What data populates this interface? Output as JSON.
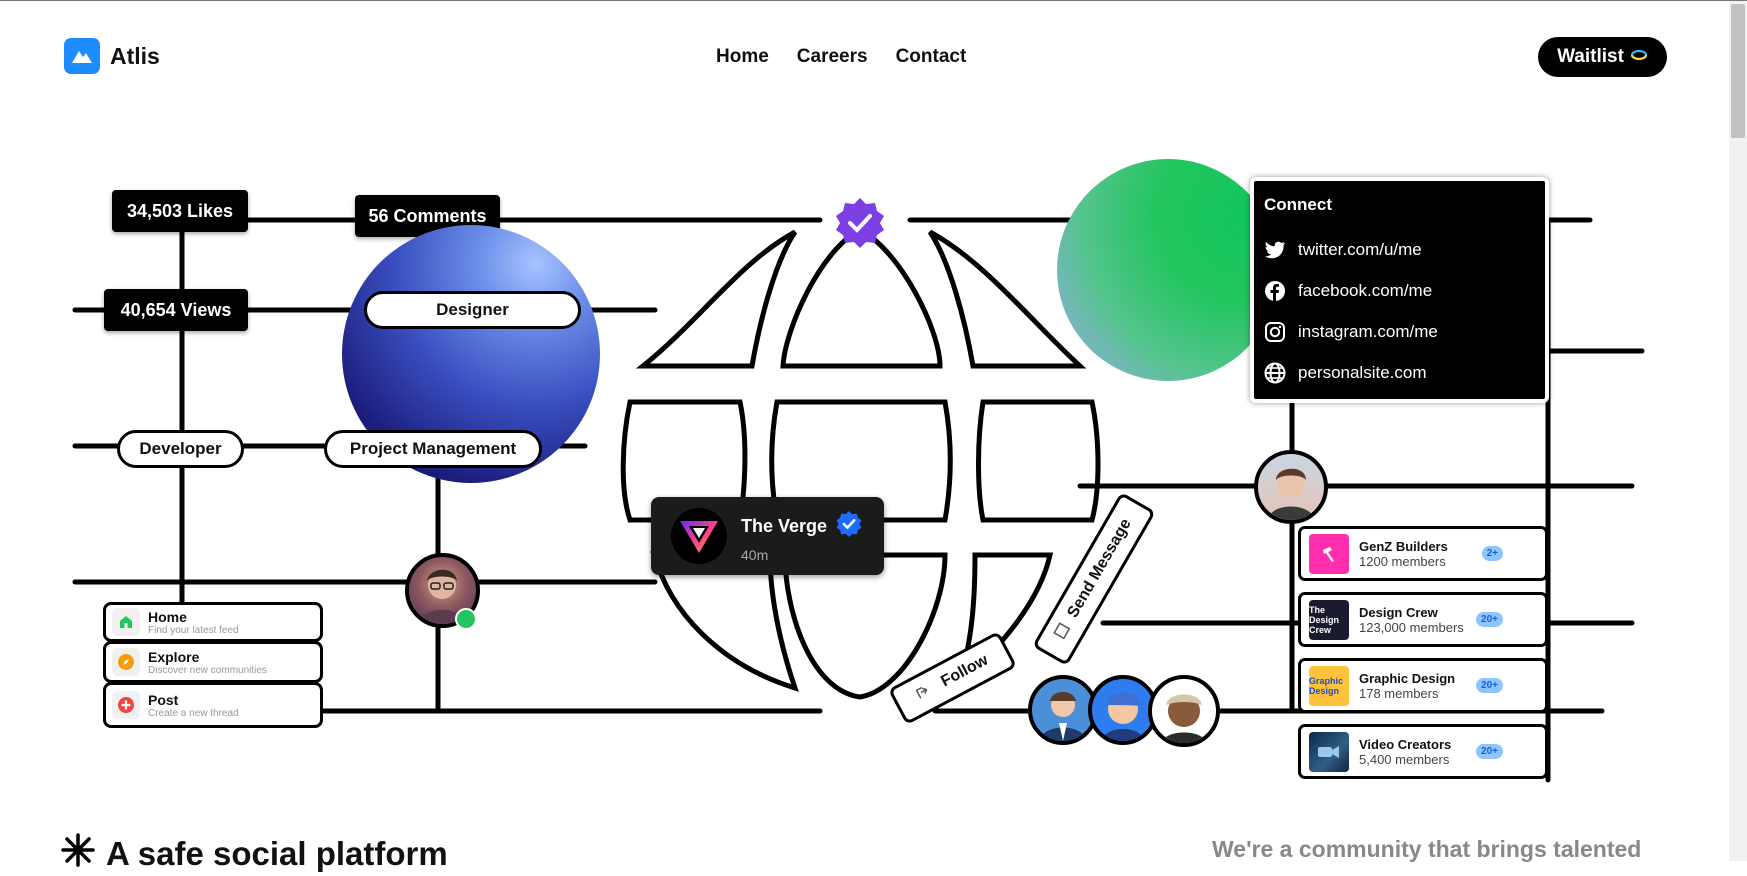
{
  "header": {
    "brand": "Atlis",
    "nav": [
      "Home",
      "Careers",
      "Contact"
    ],
    "cta": "Waitlist"
  },
  "stats": {
    "likes": "34,503 Likes",
    "comments": "56 Comments",
    "views": "40,654 Views"
  },
  "roles": {
    "designer": "Designer",
    "developer": "Developer",
    "pm": "Project Management"
  },
  "connect": {
    "title": "Connect",
    "links": [
      {
        "icon": "twitter-icon",
        "text": "twitter.com/u/me"
      },
      {
        "icon": "facebook-icon",
        "text": "facebook.com/me"
      },
      {
        "icon": "instagram-icon",
        "text": "instagram.com/me"
      },
      {
        "icon": "globe-icon",
        "text": "personalsite.com"
      }
    ]
  },
  "post": {
    "name": "The Verge",
    "time": "40m"
  },
  "actions": {
    "send_message": "Send Message",
    "follow": "Follow"
  },
  "menu": [
    {
      "title": "Home",
      "sub": "Find your latest feed",
      "icon": "home-icon",
      "color": "#22c55e"
    },
    {
      "title": "Explore",
      "sub": "Discover new communities",
      "icon": "compass-icon",
      "color": "#f59e0b"
    },
    {
      "title": "Post",
      "sub": "Create a new thread",
      "icon": "plus-icon",
      "color": "#ef4444"
    }
  ],
  "groups": [
    {
      "name": "GenZ Builders",
      "members": "1200 members",
      "badge": "2+",
      "color": "#ff2fb0",
      "icon_text": "",
      "icon": "hammer-icon"
    },
    {
      "name": "Design Crew",
      "members": "123,000 members",
      "badge": "20+",
      "color": "#1a1a2e",
      "icon_text": "The Design Crew",
      "icon": "design-crew-logo"
    },
    {
      "name": "Graphic Design",
      "members": "178 members",
      "badge": "20+",
      "color": "#ffc23a",
      "icon_text": "Graphic Design",
      "icon": "graphic-design-logo"
    },
    {
      "name": "Video Creators",
      "members": "5,400 members",
      "badge": "20+",
      "color": "#1d3a5c",
      "icon_text": "",
      "icon": "video-creators-image"
    }
  ],
  "footer": {
    "title": "A safe social platform",
    "text": "We're a community that brings talented"
  },
  "colors": {
    "brand_blue": "#1e8bff",
    "verified_purple": "#7b3fe4",
    "verified_blue": "#1d6bff",
    "online_green": "#22c55e"
  }
}
